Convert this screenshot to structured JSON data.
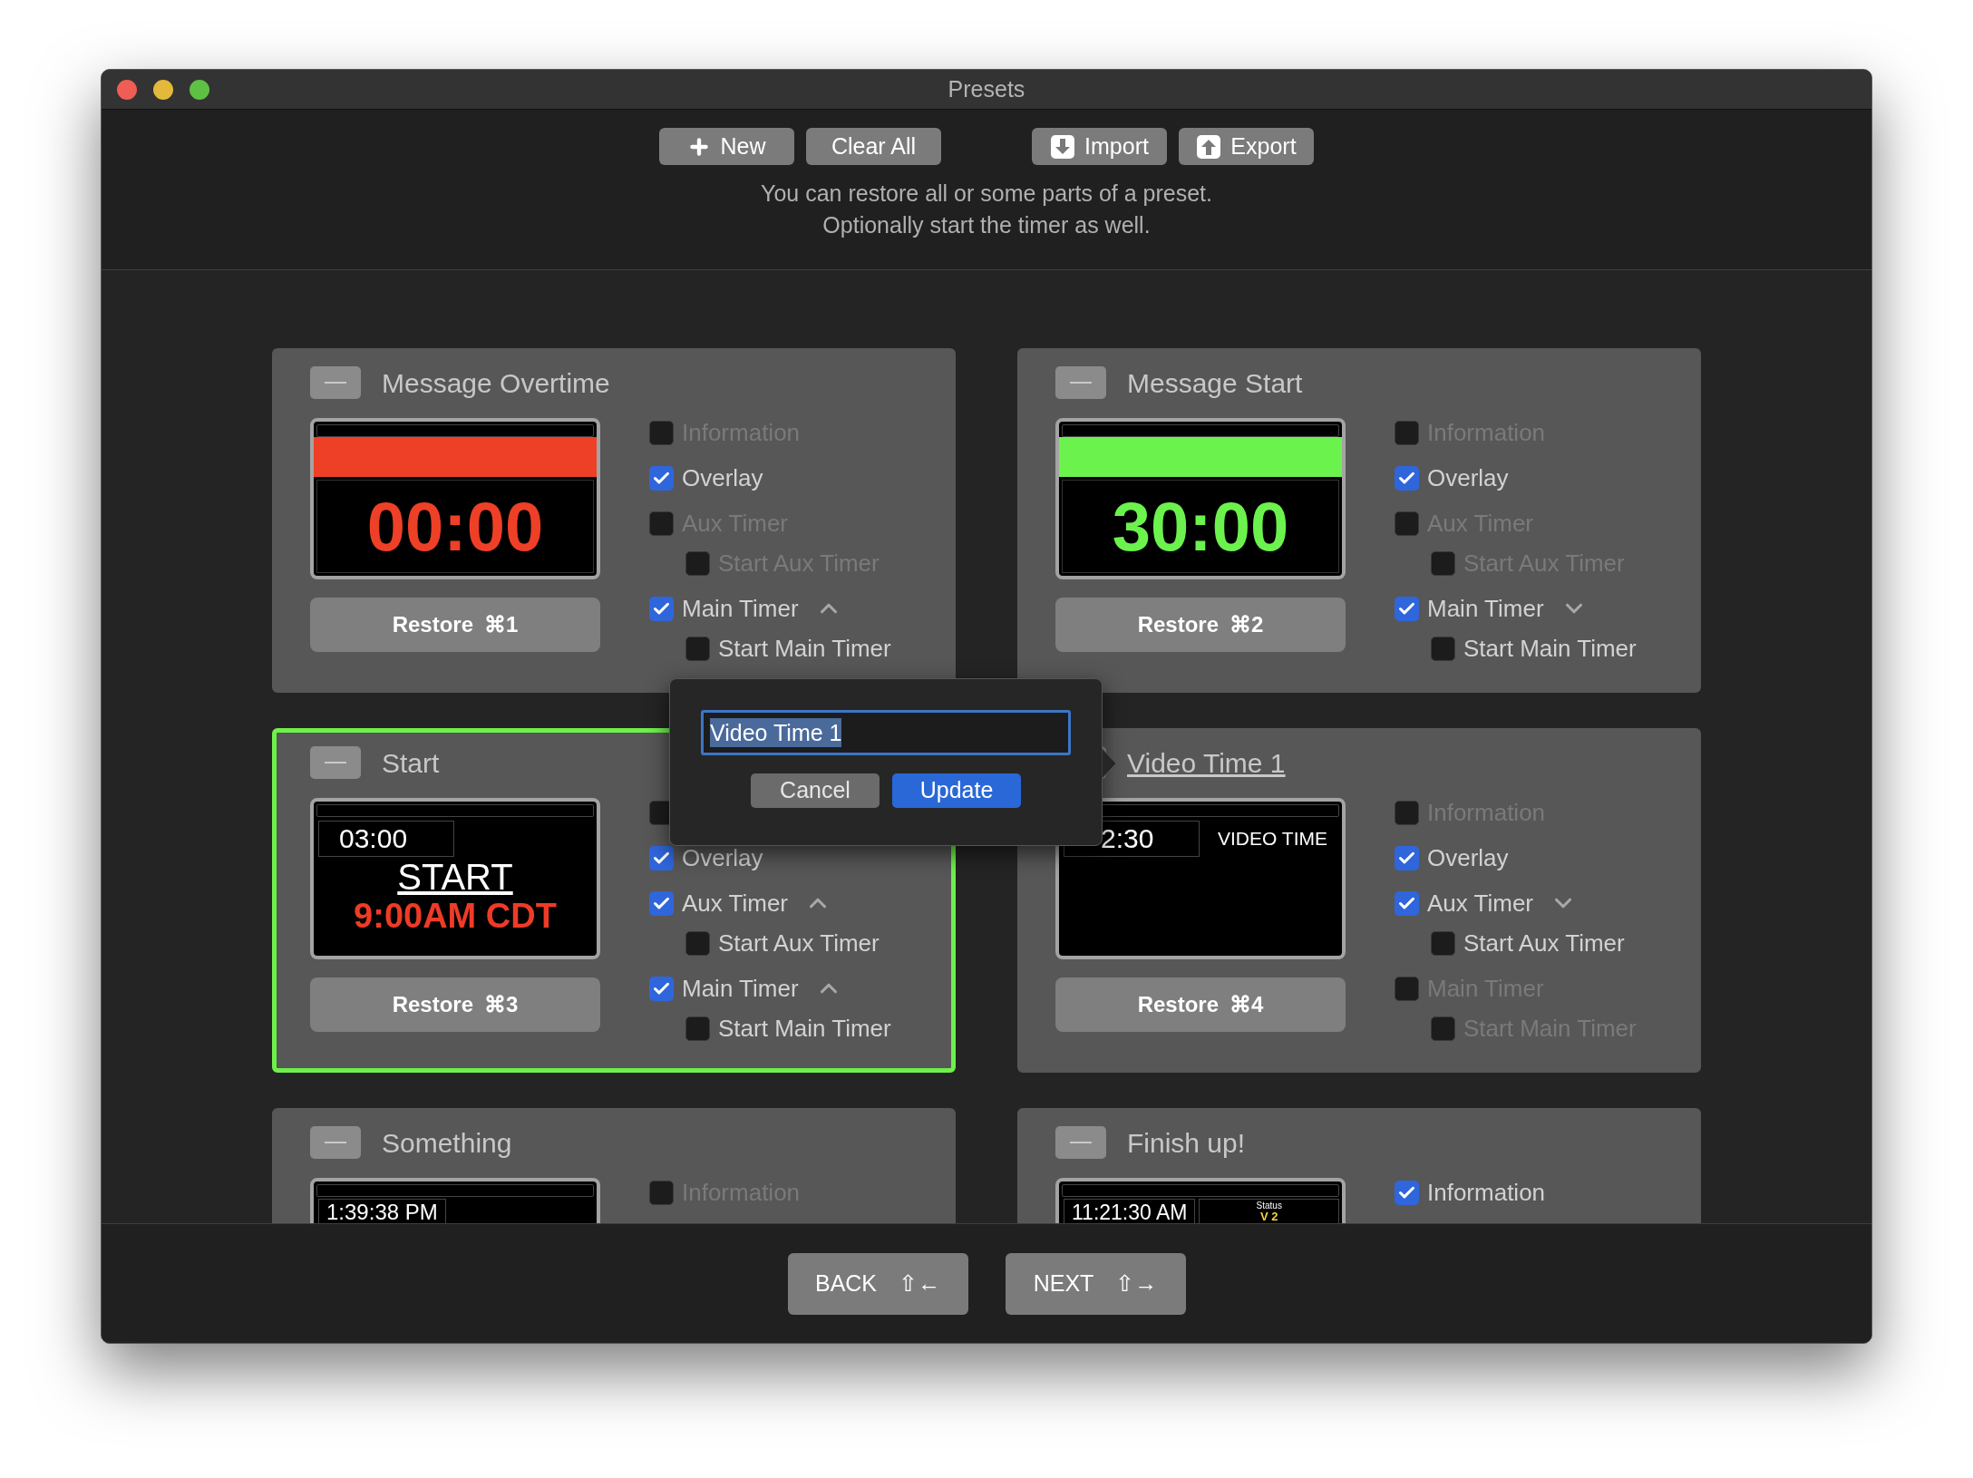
{
  "window": {
    "title": "Presets"
  },
  "toolbar": {
    "groups": [
      [
        {
          "kind": "plus",
          "label": "New"
        },
        {
          "kind": "text",
          "label": "Clear All"
        }
      ],
      [
        {
          "kind": "import",
          "label": "Import"
        },
        {
          "kind": "export",
          "label": "Export"
        }
      ]
    ]
  },
  "hint": [
    "You can restore all or some parts of a preset.",
    "Optionally start the timer as well."
  ],
  "presets": [
    {
      "title": "Message Overtime",
      "selected": false,
      "editing": false,
      "preview": {
        "kind": "bar",
        "color": "#ee4027",
        "time": "00:00"
      },
      "restore": {
        "label": "Restore",
        "shortcut": "⌘1"
      },
      "options": [
        {
          "label": "Information",
          "checked": false
        },
        {
          "label": "Overlay",
          "checked": true
        },
        {
          "label": "Aux Timer",
          "checked": false,
          "children": [
            {
              "label": "Start Aux Timer",
              "checked": false
            }
          ]
        },
        {
          "label": "Main Timer",
          "checked": true,
          "expanded": true,
          "children": [
            {
              "label": "Start Main Timer",
              "checked": false
            }
          ]
        }
      ]
    },
    {
      "title": "Message Start",
      "selected": false,
      "editing": false,
      "preview": {
        "kind": "bar",
        "color": "#6cf24d",
        "time": "30:00"
      },
      "restore": {
        "label": "Restore",
        "shortcut": "⌘2"
      },
      "options": [
        {
          "label": "Information",
          "checked": false
        },
        {
          "label": "Overlay",
          "checked": true
        },
        {
          "label": "Aux Timer",
          "checked": false,
          "children": [
            {
              "label": "Start Aux Timer",
              "checked": false
            }
          ]
        },
        {
          "label": "Main Timer",
          "checked": true,
          "expanded": false,
          "children": [
            {
              "label": "Start Main Timer",
              "checked": false
            }
          ]
        }
      ]
    },
    {
      "title": "Start",
      "selected": true,
      "editing": false,
      "preview": {
        "kind": "message",
        "time": "03:00",
        "heading": "START",
        "message": "9:00AM CDT"
      },
      "restore": {
        "label": "Restore",
        "shortcut": "⌘3"
      },
      "options": [
        {
          "checked": false
        },
        {
          "label": "Overlay",
          "checked": true
        },
        {
          "label": "Aux Timer",
          "checked": true,
          "expanded": true,
          "children": [
            {
              "label": "Start Aux Timer",
              "checked": false
            }
          ]
        },
        {
          "label": "Main Timer",
          "checked": true,
          "expanded": true,
          "children": [
            {
              "label": "Start Main Timer",
              "checked": false
            }
          ]
        }
      ]
    },
    {
      "title": "Video Time 1",
      "selected": false,
      "editing": true,
      "preview": {
        "kind": "video",
        "time": "2:30",
        "label": "VIDEO TIME"
      },
      "restore": {
        "label": "Restore",
        "shortcut": "⌘4"
      },
      "options": [
        {
          "label": "Information",
          "checked": false
        },
        {
          "label": "Overlay",
          "checked": true
        },
        {
          "label": "Aux Timer",
          "checked": true,
          "expanded": false,
          "children": [
            {
              "label": "Start Aux Timer",
              "checked": false
            }
          ]
        },
        {
          "label": "Main Timer",
          "checked": false,
          "children": [
            {
              "label": "Start Main Timer",
              "checked": false
            }
          ]
        }
      ]
    },
    {
      "title": "Something",
      "selected": false,
      "editing": false,
      "preview": {
        "kind": "clock",
        "time": "1:39:38 PM"
      },
      "options": [
        {
          "label": "Information",
          "checked": false
        }
      ]
    },
    {
      "title": "Finish up!",
      "selected": false,
      "editing": false,
      "preview": {
        "kind": "status",
        "time": "11:21:30 AM",
        "status_label": "Status",
        "status_value": "V 2"
      },
      "options": [
        {
          "label": "Information",
          "checked": true
        }
      ]
    }
  ],
  "popover": {
    "value": "Video Time 1",
    "buttons": [
      {
        "label": "Cancel",
        "primary": false
      },
      {
        "label": "Update",
        "primary": true
      }
    ]
  },
  "nav": [
    {
      "label": "BACK",
      "shortcut": "⇧←"
    },
    {
      "label": "NEXT",
      "shortcut": "⇧→"
    }
  ]
}
